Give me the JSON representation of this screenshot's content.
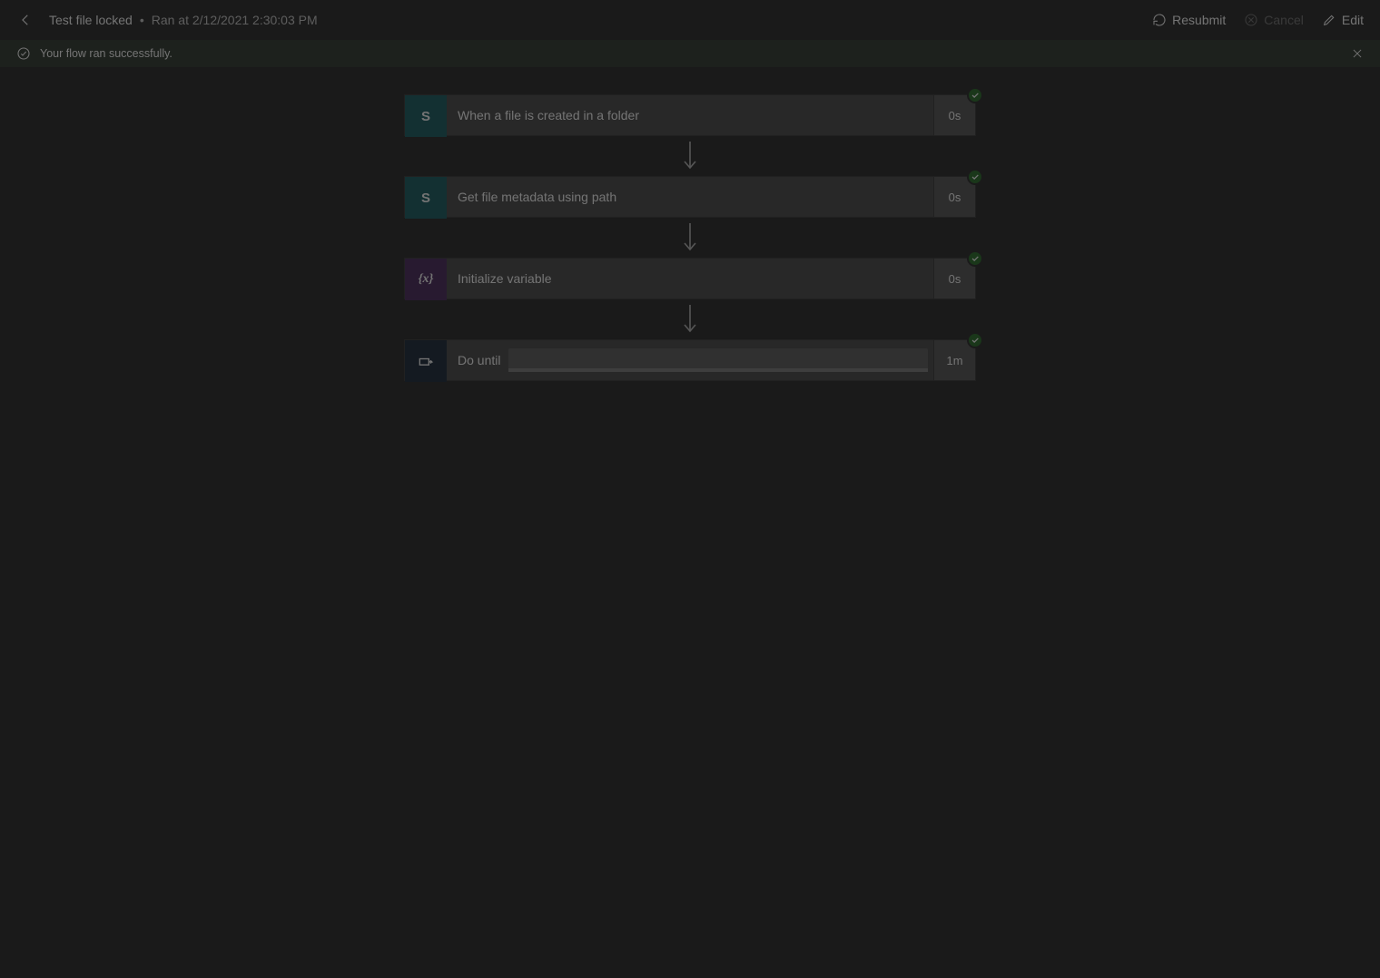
{
  "header": {
    "title": "Test file locked",
    "subtitle": "Ran at 2/12/2021 2:30:03 PM",
    "resubmit_label": "Resubmit",
    "cancel_label": "Cancel",
    "edit_label": "Edit"
  },
  "status": {
    "message": "Your flow ran successfully."
  },
  "steps": [
    {
      "icon_kind": "sp",
      "icon_text": "S",
      "label": "When a file is created in a folder",
      "duration": "0s",
      "status": "success",
      "has_bar": false
    },
    {
      "icon_kind": "sp",
      "icon_text": "S",
      "label": "Get file metadata using path",
      "duration": "0s",
      "status": "success",
      "has_bar": false
    },
    {
      "icon_kind": "var",
      "icon_text": "{x}",
      "label": "Initialize variable",
      "duration": "0s",
      "status": "success",
      "has_bar": false
    },
    {
      "icon_kind": "ctrl",
      "icon_text": "",
      "label": "Do until",
      "duration": "1m",
      "status": "success",
      "has_bar": true
    }
  ]
}
